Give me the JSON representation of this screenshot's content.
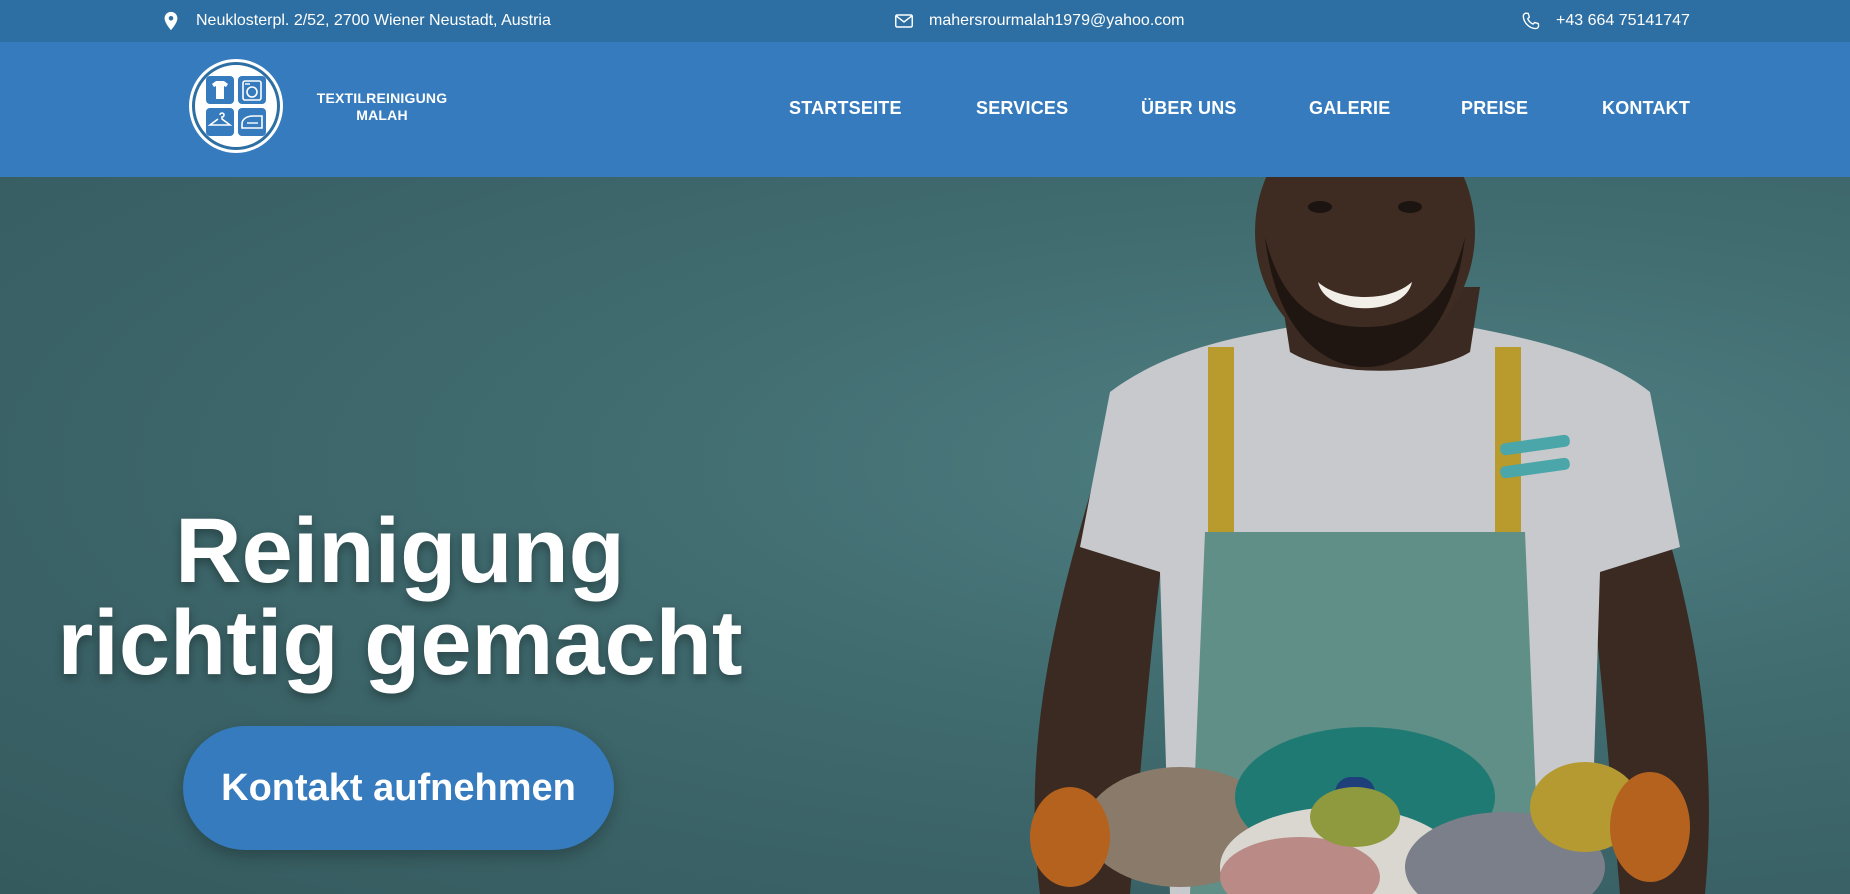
{
  "topbar": {
    "address": "Neuklosterpl. 2/52, 2700 Wiener Neustadt, Austria",
    "address_icon": "location-pin-icon",
    "email": "mahersrourmalah1979@yahoo.com",
    "email_icon": "envelope-icon",
    "phone": "+43 664 75141747",
    "phone_icon": "phone-icon"
  },
  "brand": {
    "line1": "TEXTILREINIGUNG",
    "line2": "MALAH"
  },
  "nav": {
    "items": [
      {
        "label": "STARTSEITE"
      },
      {
        "label": "SERVICES"
      },
      {
        "label": "ÜBER UNS"
      },
      {
        "label": "GALERIE"
      },
      {
        "label": "PREISE"
      },
      {
        "label": "KONTAKT"
      }
    ]
  },
  "hero": {
    "title_line1": "Reinigung",
    "title_line2": "richtig gemacht",
    "cta_label": "Kontakt aufnehmen"
  },
  "colors": {
    "topbar_bg": "#2d6fa3",
    "header_bg": "#357bbd",
    "hero_bg": "#3f6a6e",
    "button_bg": "#357bbd"
  }
}
